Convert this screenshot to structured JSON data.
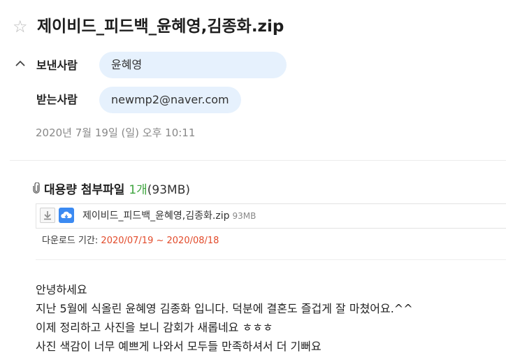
{
  "mail": {
    "subject": "제이비드_피드백_윤혜영,김종화.zip",
    "sender_label": "보낸사람",
    "sender_name": "윤혜영",
    "recipient_label": "받는사람",
    "recipient_email": "newmp2@naver.com",
    "date": "2020년 7월 19일 (일) 오후 10:11"
  },
  "attachment": {
    "title": "대용량 첨부파일",
    "count": "1개",
    "total_size": "(93MB)",
    "file_name": "제이비드_피드백_윤혜영,김종화.zip",
    "file_size": "93MB",
    "period_label": "다운로드 기간:",
    "period_range": "2020/07/19 ~ 2020/08/18"
  },
  "body_lines": [
    "안녕하세요",
    "지난 5월에 식올린 윤혜영 김종화 입니다. 덕분에 결혼도 즐겁게 잘 마쳤어요.^^",
    "이제 정리하고 사진을 보니 감회가 새롭네요 ㅎㅎㅎ",
    "사진 색감이 너무 예쁘게 나와서 모두들 만족하셔서 더 기뻐요"
  ],
  "icons": {
    "star": "star-outline-icon",
    "collapse": "chevron-up-icon",
    "clip": "paperclip-icon",
    "download": "download-icon",
    "cloud": "cloud-save-icon"
  },
  "colors": {
    "pill_bg": "#e6f1fd",
    "count_green": "#3fa53f",
    "period_red": "#e24b2b",
    "cloud_blue": "#3b8af2"
  }
}
